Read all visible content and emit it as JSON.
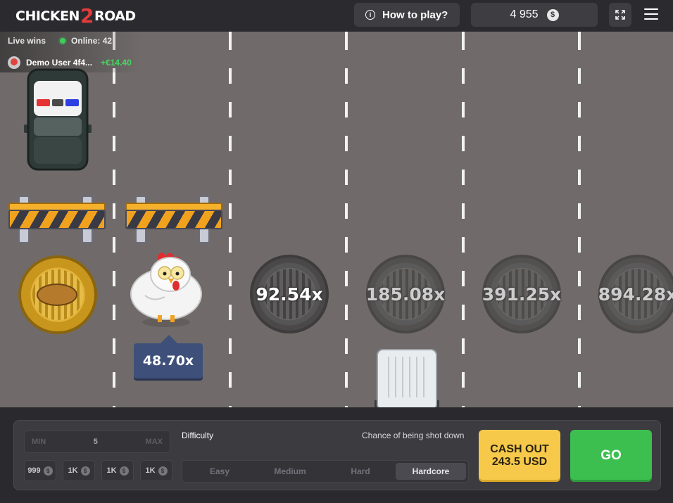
{
  "header": {
    "logo_text_left": "CHICKEN",
    "logo_text_mid": "2",
    "logo_text_right": "ROAD",
    "how_to_play": "How to play?",
    "balance": "4 955",
    "currency_symbol": "$"
  },
  "live": {
    "label": "Live wins",
    "online": "Online: 42",
    "user": "Demo User 4f4...",
    "win": "+€14.40"
  },
  "road": {
    "current_multiplier": "48.70x",
    "multipliers": [
      "92.54x",
      "185.08x",
      "391.25x",
      "894.28x"
    ]
  },
  "controls": {
    "min": "MIN",
    "bet": "5",
    "max": "MAX",
    "chips": [
      {
        "label": "999",
        "icon": "$"
      },
      {
        "label": "1K",
        "icon": "$"
      },
      {
        "label": "1K",
        "icon": "$"
      },
      {
        "label": "1K",
        "icon": "$"
      }
    ],
    "difficulty_label": "Difficulty",
    "chance_label": "Chance of being shot down",
    "difficulties": [
      "Easy",
      "Medium",
      "Hard",
      "Hardcore"
    ],
    "active_difficulty": "Hardcore",
    "cashout_line1": "CASH OUT",
    "cashout_line2": "243.5 USD",
    "go": "GO"
  },
  "colors": {
    "road": "#706b6a",
    "go": "#3cbf4f",
    "cashout": "#f6c94a",
    "win": "#47d85e",
    "tag": "#3e5079"
  }
}
